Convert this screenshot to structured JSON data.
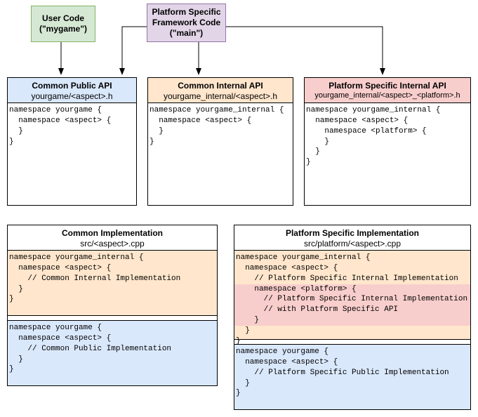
{
  "colors": {
    "green": "#d5e8d4",
    "purple": "#e1d5e7",
    "blue": "#dae8fc",
    "orange": "#ffe6cc",
    "red": "#f8cecc"
  },
  "top": {
    "user_code": {
      "line1": "User Code",
      "line2": "(\"mygame\")"
    },
    "framework": {
      "line1": "Platform Specific",
      "line2": "Framework Code",
      "line3": "(\"main\")"
    }
  },
  "api": {
    "public": {
      "title": "Common Public API",
      "path": "yourgame/<aspect>.h",
      "code": "namespace yourgame {\n  namespace <aspect> {\n  }\n}"
    },
    "internal": {
      "title": "Common Internal API",
      "path": "yourgame_internal/<aspect>.h",
      "code": "namespace yourgame_internal {\n  namespace <aspect> {\n  }\n}"
    },
    "platform_internal": {
      "title": "Platform Specific Internal API",
      "path": "yourgame_internal/<aspect>_<platform>.h",
      "code": "namespace yourgame_internal {\n  namespace <aspect> {\n    namespace <platform> {\n    }\n  }\n}"
    }
  },
  "impl": {
    "common": {
      "title": "Common Implementation",
      "path": "src/<aspect>.cpp",
      "internal_code": "namespace yourgame_internal {\n  namespace <aspect> {\n    // Common Internal Implementation\n  }\n}",
      "public_code": "namespace yourgame {\n  namespace <aspect> {\n    // Common Public Implementation\n  }\n}"
    },
    "platform": {
      "title": "Platform Specific Implementation",
      "path": "src/platform/<aspect>.cpp",
      "internal_head": "namespace yourgame_internal {\n  namespace <aspect> {\n    // Platform Specific Internal Implementation",
      "internal_platform": "    namespace <platform> {\n      // Platform Specific Internal Implementation\n      // with Platform Specific API\n    }",
      "internal_tail": "  }\n}",
      "public_code": "namespace yourgame {\n  namespace <aspect> {\n    // Platform Specific Public Implementation\n  }\n}"
    }
  }
}
